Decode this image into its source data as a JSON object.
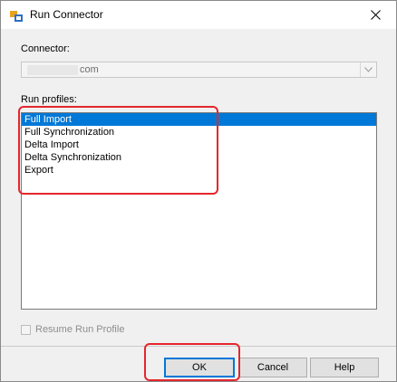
{
  "window": {
    "title": "Run Connector"
  },
  "connector": {
    "label": "Connector:",
    "value": "com"
  },
  "run_profiles": {
    "label": "Run profiles:",
    "items": [
      "Full Import",
      "Full Synchronization",
      "Delta Import",
      "Delta Synchronization",
      "Export"
    ],
    "selected_index": 0
  },
  "resume": {
    "label": "Resume Run Profile",
    "checked": false,
    "enabled": false
  },
  "buttons": {
    "ok": "OK",
    "cancel": "Cancel",
    "help": "Help"
  },
  "icons": {
    "app": "run-connector-app-icon",
    "close": "close-icon",
    "dropdown": "chevron-down-icon"
  },
  "colors": {
    "selection": "#0078d7",
    "highlight": "#e4262c"
  }
}
